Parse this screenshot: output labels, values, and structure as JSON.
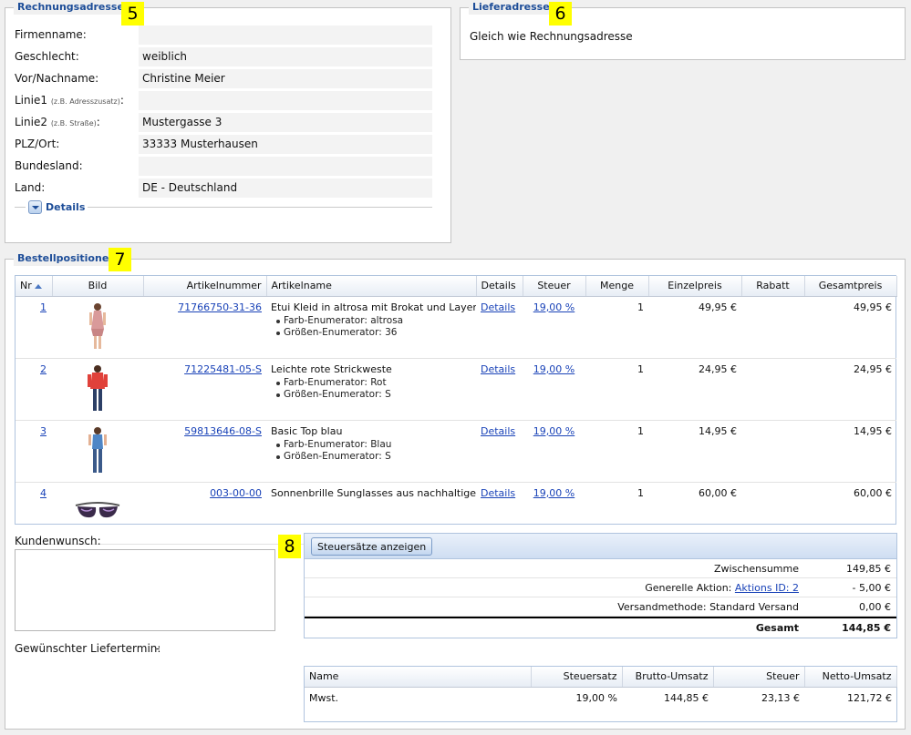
{
  "billing": {
    "legend": "Rechnungsadresse",
    "marker": "5",
    "rows": [
      {
        "label": "Firmenname:",
        "hint": "",
        "value": ""
      },
      {
        "label": "Geschlecht:",
        "hint": "",
        "value": "weiblich"
      },
      {
        "label": "Vor/Nachname:",
        "hint": "",
        "value": "Christine Meier"
      },
      {
        "label": "Linie1",
        "hint": "(z.B. Adresszusatz)",
        "suffix": ":",
        "value": ""
      },
      {
        "label": "Linie2",
        "hint": "(z.B. Straße)",
        "suffix": ":",
        "value": "Mustergasse 3"
      },
      {
        "label": "PLZ/Ort:",
        "hint": "",
        "value": "33333 Musterhausen"
      },
      {
        "label": "Bundesland:",
        "hint": "",
        "value": ""
      },
      {
        "label": "Land:",
        "hint": "",
        "value": "DE - Deutschland"
      }
    ],
    "details_label": "Details"
  },
  "delivery": {
    "legend": "Lieferadresse",
    "marker": "6",
    "text": "Gleich wie Rechnungsadresse"
  },
  "positions": {
    "legend": "Bestellpositionen",
    "marker": "7",
    "columns": [
      "Nr",
      "Bild",
      "Artikelnummer",
      "Artikelname",
      "Details",
      "Steuer",
      "Menge",
      "Einzelpreis",
      "Rabatt",
      "Gesamtpreis"
    ],
    "rows": [
      {
        "nr": "1",
        "sku": "71766750-31-36",
        "name": "Etui Kleid in altrosa mit Brokat und Layer-Look",
        "attrs": [
          "Farb-Enumerator: altrosa",
          "Größen-Enumerator: 36"
        ],
        "details": "Details",
        "tax": "19,00 %",
        "qty": "1",
        "unit": "49,95 €",
        "discount": "",
        "total": "49,95 €"
      },
      {
        "nr": "2",
        "sku": "71225481-05-S",
        "name": "Leichte rote Strickweste",
        "attrs": [
          "Farb-Enumerator: Rot",
          "Größen-Enumerator: S"
        ],
        "details": "Details",
        "tax": "19,00 %",
        "qty": "1",
        "unit": "24,95 €",
        "discount": "",
        "total": "24,95 €"
      },
      {
        "nr": "3",
        "sku": "59813646-08-S",
        "name": "Basic Top blau",
        "attrs": [
          "Farb-Enumerator: Blau",
          "Größen-Enumerator: S"
        ],
        "details": "Details",
        "tax": "19,00 %",
        "qty": "1",
        "unit": "14,95 €",
        "discount": "",
        "total": "14,95 €"
      },
      {
        "nr": "4",
        "sku": "003-00-00",
        "name": "Sonnenbrille Sunglasses aus nachhaltigen M...",
        "attrs": [],
        "details": "Details",
        "tax": "19,00 %",
        "qty": "1",
        "unit": "60,00 €",
        "discount": "",
        "total": "60,00 €"
      }
    ]
  },
  "wish": {
    "label": "Kundenwunsch:",
    "value": "",
    "delivery_date_label": "Gewünschter Liefertermin:",
    "delivery_date_value": "-"
  },
  "totals": {
    "marker": "8",
    "tax_button": "Steuersätze anzeigen",
    "subtotal_label": "Zwischensumme",
    "subtotal_value": "149,85 €",
    "action_label": "Generelle Aktion:",
    "action_link": "Aktions ID: 2",
    "action_value": "- 5,00 €",
    "shipping_label": "Versandmethode: Standard Versand",
    "shipping_value": "0,00 €",
    "total_label": "Gesamt",
    "total_value": "144,85 €"
  },
  "taxes": {
    "columns": [
      "Name",
      "Steuersatz",
      "Brutto-Umsatz",
      "Steuer",
      "Netto-Umsatz"
    ],
    "rows": [
      {
        "name": "Mwst.",
        "rate": "19,00 %",
        "gross": "144,85 €",
        "tax": "23,13 €",
        "net": "121,72 €"
      }
    ]
  },
  "colors": {
    "legend": "#1d4d98",
    "link": "#1a43b8",
    "marker": "#ffff00"
  }
}
